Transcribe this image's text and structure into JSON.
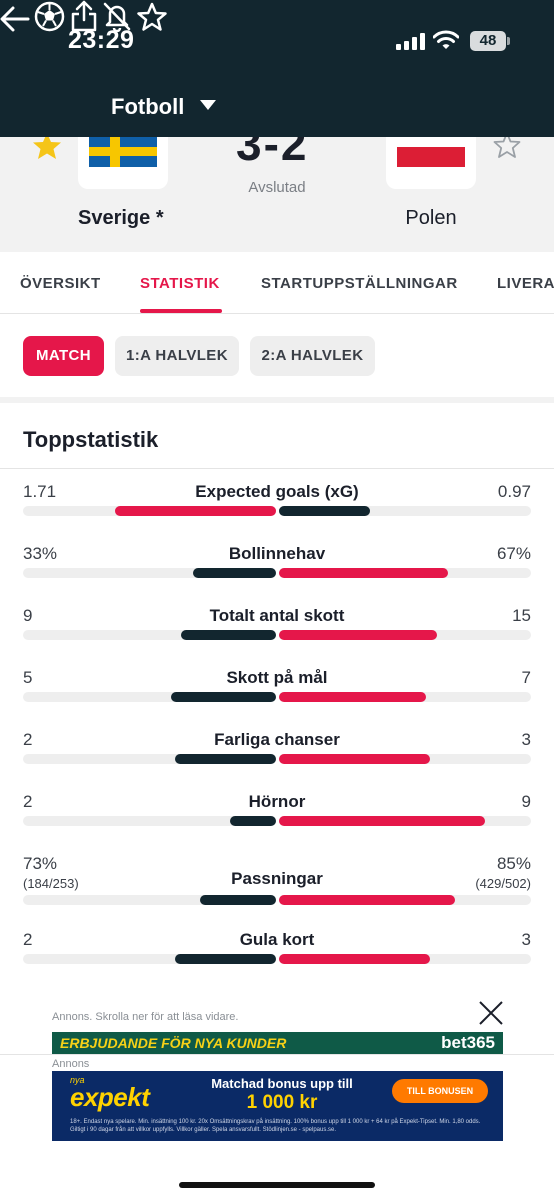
{
  "status_bar": {
    "time": "23:29",
    "battery": "48"
  },
  "nav": {
    "title": "Fotboll"
  },
  "match": {
    "home_team": "Sverige *",
    "away_team": "Polen",
    "score": "3-2",
    "status": "Avslutad"
  },
  "tabs": [
    {
      "label": "ÖVERSIKT"
    },
    {
      "label": "STATISTIK"
    },
    {
      "label": "STARTUPPSTÄLLNINGAR"
    },
    {
      "label": "LIVERA"
    }
  ],
  "periods": [
    {
      "label": "MATCH"
    },
    {
      "label": "1:A HALVLEK"
    },
    {
      "label": "2:A HALVLEK"
    }
  ],
  "section_title": "Toppstatistik",
  "colors": {
    "accent": "#e5174a",
    "dark": "#12262f",
    "track": "#eeeeee"
  },
  "stats": [
    {
      "name": "Expected goals (xG)",
      "home": "1.71",
      "away": "0.97",
      "home_val": 1.71,
      "away_val": 0.97,
      "leader": "home"
    },
    {
      "name": "Bollinnehav",
      "home": "33%",
      "away": "67%",
      "home_val": 33,
      "away_val": 67,
      "leader": "away"
    },
    {
      "name": "Totalt antal skott",
      "home": "9",
      "away": "15",
      "home_val": 9,
      "away_val": 15,
      "leader": "away"
    },
    {
      "name": "Skott på mål",
      "home": "5",
      "away": "7",
      "home_val": 5,
      "away_val": 7,
      "leader": "away"
    },
    {
      "name": "Farliga chanser",
      "home": "2",
      "away": "3",
      "home_val": 2,
      "away_val": 3,
      "leader": "away"
    },
    {
      "name": "Hörnor",
      "home": "2",
      "away": "9",
      "home_val": 2,
      "away_val": 9,
      "leader": "away"
    },
    {
      "name": "Passningar",
      "home": "73%",
      "away": "85%",
      "home_sub": "(184/253)",
      "away_sub": "(429/502)",
      "home_val": 184,
      "away_val": 429,
      "leader": "away"
    },
    {
      "name": "Gula kort",
      "home": "2",
      "away": "3",
      "home_val": 2,
      "away_val": 3,
      "leader": "away"
    }
  ],
  "ads": {
    "notice": "Annons. Skrolla ner för att läsa vidare.",
    "top_banner_text": "ERBJUDANDE FÖR NYA KUNDER",
    "top_banner_brand": "bet365",
    "label": "Annons",
    "brand_small": "nya",
    "brand": "expekt",
    "headline": "Matchad bonus upp till",
    "amount": "1 000 kr",
    "cta": "TILL BONUSEN",
    "fine_print": "18+. Endast nya spelare. Min. insättning 100 kr. 20x Omsättningskrav på insättning. 100% bonus upp till 1 000 kr + 64 kr på Expekt-Tipset. Min. 1,80 odds. Giltigt i 90 dagar från att villkor uppfylls. Villkor gäller. Spela ansvarsfullt. Stödlinjen.se - spelpaus.se."
  }
}
